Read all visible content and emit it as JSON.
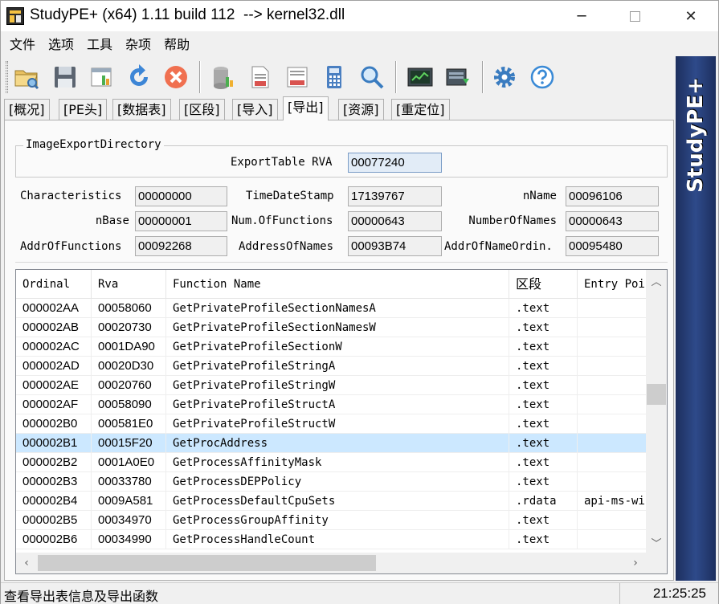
{
  "window": {
    "title": "StudyPE+ (x64) 1.11 build 112  --> kernel32.dll",
    "minimize_glyph": "─",
    "close_glyph": "✕"
  },
  "menu": [
    "文件",
    "选项",
    "工具",
    "杂项",
    "帮助"
  ],
  "toolbar_icons": [
    "open-file-icon",
    "save-icon",
    "pe-view-icon",
    "refresh-icon",
    "close-file-icon",
    "database-icon",
    "asm-doc-icon",
    "asm-list-icon",
    "calculator-icon",
    "search-icon",
    "terminal-icon",
    "process-icon",
    "settings-icon",
    "help-icon"
  ],
  "tabs": [
    "[概况]",
    "[PE头]",
    "[数据表]",
    "[区段]",
    "[导入]",
    "[导出]",
    "[资源]",
    "[重定位]"
  ],
  "active_tab": "[导出]",
  "side_banner": "StudyPE+",
  "export_directory": {
    "group_title": "ImageExportDirectory",
    "export_table_rva_label": "ExportTable RVA",
    "export_table_rva": "00077240",
    "characteristics_label": "Characteristics",
    "characteristics": "00000000",
    "timedatestamp_label": "TimeDateStamp",
    "timedatestamp": "17139767",
    "nname_label": "nName",
    "nname": "00096106",
    "nbase_label": "nBase",
    "nbase": "00000001",
    "numoffunctions_label": "Num.OfFunctions",
    "numoffunctions": "00000643",
    "numberofnames_label": "NumberOfNames",
    "numberofnames": "00000643",
    "addroffunctions_label": "AddrOfFunctions",
    "addroffunctions": "00092268",
    "addressofnames_label": "AddressOfNames",
    "addressofnames": "00093B74",
    "addrofnameordin_label": "AddrOfNameOrdin.",
    "addrofnameordin": "00095480"
  },
  "list": {
    "columns": [
      "Ordinal",
      "Rva",
      "Function Name",
      "区段",
      "Entry Poi"
    ],
    "rows": [
      {
        "ordinal": "000002AA",
        "rva": "00058060",
        "name": "GetPrivateProfileSectionNamesA",
        "section": ".text",
        "entry": ""
      },
      {
        "ordinal": "000002AB",
        "rva": "00020730",
        "name": "GetPrivateProfileSectionNamesW",
        "section": ".text",
        "entry": ""
      },
      {
        "ordinal": "000002AC",
        "rva": "0001DA90",
        "name": "GetPrivateProfileSectionW",
        "section": ".text",
        "entry": ""
      },
      {
        "ordinal": "000002AD",
        "rva": "00020D30",
        "name": "GetPrivateProfileStringA",
        "section": ".text",
        "entry": ""
      },
      {
        "ordinal": "000002AE",
        "rva": "00020760",
        "name": "GetPrivateProfileStringW",
        "section": ".text",
        "entry": ""
      },
      {
        "ordinal": "000002AF",
        "rva": "00058090",
        "name": "GetPrivateProfileStructA",
        "section": ".text",
        "entry": ""
      },
      {
        "ordinal": "000002B0",
        "rva": "000581E0",
        "name": "GetPrivateProfileStructW",
        "section": ".text",
        "entry": ""
      },
      {
        "ordinal": "000002B1",
        "rva": "00015F20",
        "name": "GetProcAddress",
        "section": ".text",
        "entry": ""
      },
      {
        "ordinal": "000002B2",
        "rva": "0001A0E0",
        "name": "GetProcessAffinityMask",
        "section": ".text",
        "entry": ""
      },
      {
        "ordinal": "000002B3",
        "rva": "00033780",
        "name": "GetProcessDEPPolicy",
        "section": ".text",
        "entry": ""
      },
      {
        "ordinal": "000002B4",
        "rva": "0009A581",
        "name": "GetProcessDefaultCpuSets",
        "section": ".rdata",
        "entry": "api-ms-wi"
      },
      {
        "ordinal": "000002B5",
        "rva": "00034970",
        "name": "GetProcessGroupAffinity",
        "section": ".text",
        "entry": ""
      },
      {
        "ordinal": "000002B6",
        "rva": "00034990",
        "name": "GetProcessHandleCount",
        "section": ".text",
        "entry": ""
      }
    ],
    "selected_ordinal": "000002B1"
  },
  "status": {
    "message": "查看导出表信息及导出函数",
    "time": "21:25:25"
  }
}
